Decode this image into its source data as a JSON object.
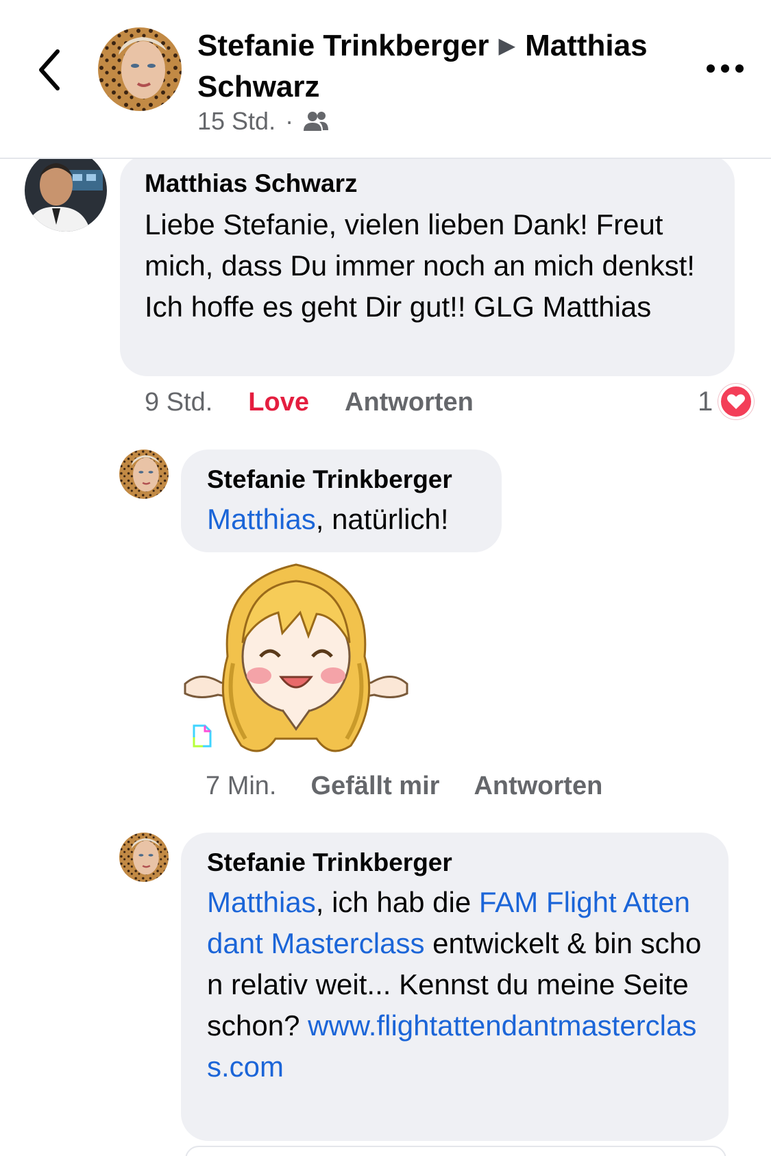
{
  "header": {
    "author": "Stefanie Trinkberger",
    "arrow": "▶",
    "target": "Matthias Schwarz",
    "time": "15 Std.",
    "separator": "·",
    "audience_icon": "friends-icon"
  },
  "comments": [
    {
      "author": "Matthias Schwarz",
      "text": "Liebe Stefanie, vielen lieben Dank! Freut mich, dass Du immer noch an mich denkst! Ich hoffe es geht Dir gut!! GLG Matthias",
      "time": "9 Std.",
      "reaction_label": "Love",
      "reply_label": "Antworten",
      "reaction_count": "1",
      "reaction_icon": "heart-icon"
    },
    {
      "author": "Stefanie Trinkberger",
      "mention": "Matthias",
      "text_after": ", natürlich!",
      "sticker_icon": "waving-girl-sticker",
      "time": "7 Min.",
      "like_label": "Gefällt mir",
      "reply_label": "Antworten"
    },
    {
      "author": "Stefanie Trinkberger",
      "mention": "Matthias",
      "text_part1": ", ich hab die ",
      "link_page": "FAM Flight Attendant Masterclass",
      "text_part2": " entwickelt & bin schon relativ weit... Kennst du meine Seite schon? ",
      "url": "www.flightattendantmasterclass.com"
    }
  ],
  "colors": {
    "link": "#1b65d8",
    "love": "#e41e3f",
    "bubble": "#eff0f4",
    "meta": "#65676b"
  }
}
